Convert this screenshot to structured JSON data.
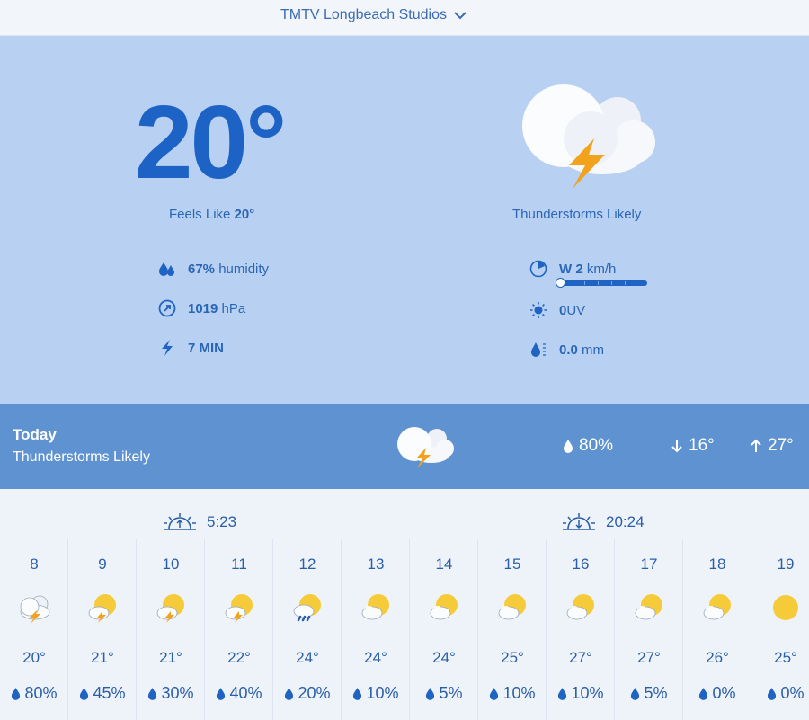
{
  "location": {
    "name": "TMTV Longbeach Studios"
  },
  "current": {
    "temperature": "20°",
    "feels_like_label": "Feels Like",
    "feels_like_value": "20°",
    "condition": "Thunderstorms Likely",
    "humidity_value": "67%",
    "humidity_label": "humidity",
    "pressure_value": "1019",
    "pressure_unit": "hPa",
    "lightning": "7 MIN",
    "wind_value": "W 2",
    "wind_unit": "km/h",
    "uv_value": "0",
    "uv_label": "UV",
    "precip_value": "0.0",
    "precip_unit": "mm"
  },
  "today": {
    "title": "Today",
    "condition": "Thunderstorms Likely",
    "precip_chance": "80%",
    "low": "16°",
    "high": "27°"
  },
  "sun_events": {
    "sunrise": "5:23",
    "sunset": "20:24"
  },
  "hours": [
    {
      "hour": "8",
      "temp": "20°",
      "precip": "80%",
      "icon": "thunder-cloud-icon"
    },
    {
      "hour": "9",
      "temp": "21°",
      "precip": "45%",
      "icon": "sun-thunder-icon"
    },
    {
      "hour": "10",
      "temp": "21°",
      "precip": "30%",
      "icon": "sun-thunder-icon"
    },
    {
      "hour": "11",
      "temp": "22°",
      "precip": "40%",
      "icon": "sun-thunder-icon"
    },
    {
      "hour": "12",
      "temp": "24°",
      "precip": "20%",
      "icon": "sun-rain-icon"
    },
    {
      "hour": "13",
      "temp": "24°",
      "precip": "10%",
      "icon": "partly-cloudy-icon"
    },
    {
      "hour": "14",
      "temp": "24°",
      "precip": "5%",
      "icon": "partly-cloudy-icon"
    },
    {
      "hour": "15",
      "temp": "25°",
      "precip": "10%",
      "icon": "partly-cloudy-icon"
    },
    {
      "hour": "16",
      "temp": "27°",
      "precip": "10%",
      "icon": "partly-cloudy-icon"
    },
    {
      "hour": "17",
      "temp": "27°",
      "precip": "5%",
      "icon": "partly-cloudy-icon"
    },
    {
      "hour": "18",
      "temp": "26°",
      "precip": "0%",
      "icon": "partly-cloudy-icon"
    },
    {
      "hour": "19",
      "temp": "25°",
      "precip": "0%",
      "icon": "sun-icon"
    }
  ],
  "colors": {
    "accent": "#1d63c6",
    "panel": "#b8d0f1",
    "today_band": "#5f92d0",
    "sun": "#f6cb3a",
    "bolt": "#f2a21c"
  }
}
